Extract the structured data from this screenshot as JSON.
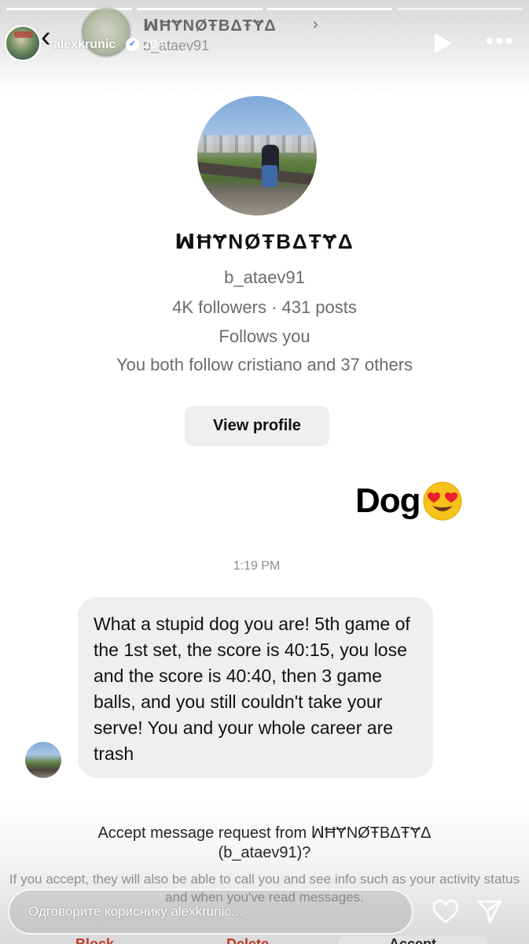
{
  "story": {
    "username": "alexkrunic",
    "verified": true,
    "time": "20 ч",
    "reply_placeholder": "Одговорите кориснику alexkrunic...",
    "icons": [
      "back-chevron-icon",
      "verified-icon",
      "play-icon",
      "more-icon",
      "heart-icon",
      "send-icon"
    ]
  },
  "dm_header_ghost": {
    "name": "ꟽĦɎNØŦBΔŦɎΔ",
    "handle": "b_ataev91"
  },
  "profile": {
    "name": "ꟽĦɎNØŦBΔŦɎΔ",
    "handle": "b_ataev91",
    "stats": "4K followers · 431 posts",
    "follows_you": "Follows you",
    "mutual": "You both follow cristiano and 37 others",
    "view_profile_label": "View profile"
  },
  "sticker": {
    "text": "Dog",
    "emoji": "heart-eyes-emoji"
  },
  "chat": {
    "timestamp": "1:19 PM",
    "messages": [
      {
        "direction": "incoming",
        "text": "What a stupid dog you are! 5th game of the 1st set, the score is 40:15, you lose and the score is 40:40, then 3 game balls, and you still couldn't take your serve! You and your whole career are trash"
      }
    ]
  },
  "request": {
    "title_line1": "Accept message request from ꟽĦɎNØŦBΔŦɎΔ",
    "title_line2": "(b_ataev91)?",
    "info": "If you accept, they will also be able to call you and see info such as your activity status and when you've read messages.",
    "actions": [
      "Block",
      "Delete",
      "Accept"
    ]
  },
  "colors": {
    "danger": "#c0392b",
    "button_bg": "#efefef",
    "secondary_text": "#6b6b6b"
  }
}
